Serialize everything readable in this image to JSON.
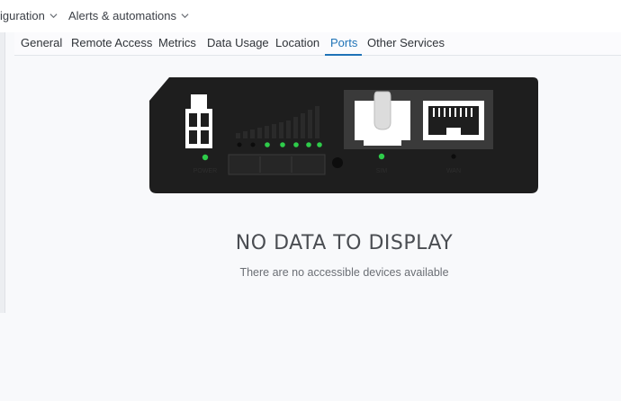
{
  "top_nav": {
    "configuration_label": "iguration",
    "alerts_label": "Alerts & automations"
  },
  "tabs": [
    {
      "label": "General"
    },
    {
      "label": "Remote Access"
    },
    {
      "label": "Metrics"
    },
    {
      "label": "Data Usage"
    },
    {
      "label": "Location"
    },
    {
      "label": "Ports",
      "active": true
    },
    {
      "label": "Other Services"
    }
  ],
  "device": {
    "led_color": "#2ecc4a",
    "port_labels": [
      "POWER",
      "SIM",
      "WAN"
    ]
  },
  "empty_state": {
    "title": "NO DATA TO DISPLAY",
    "subtitle": "There are no accessible devices available"
  },
  "colors": {
    "accent": "#1f73b7",
    "device_body": "#1e1e1e"
  },
  "icons": {
    "dropdown": "chevron-down-icon"
  }
}
